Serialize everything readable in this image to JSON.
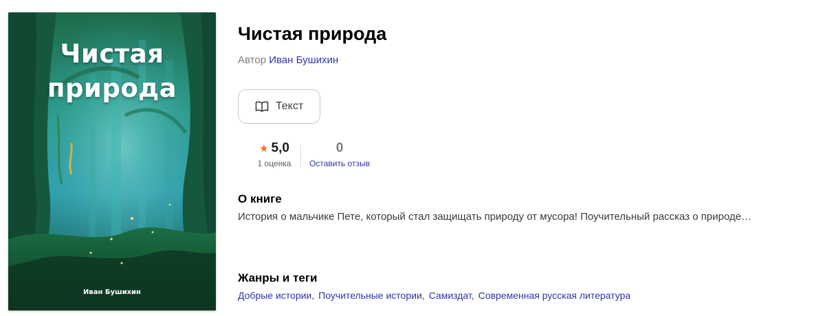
{
  "cover": {
    "title_line1": "Чистая",
    "title_line2": "природа",
    "author": "Иван Бушихин"
  },
  "book": {
    "title": "Чистая природа",
    "author_prefix": "Автор",
    "author_name": "Иван Бушихин"
  },
  "format_button": {
    "label": "Текст",
    "icon": "open-book-icon"
  },
  "rating": {
    "value": "5,0",
    "count_label": "1 оценка",
    "star_color": "#f06a22"
  },
  "reviews": {
    "count": "0",
    "link_label": "Оставить отзыв"
  },
  "about": {
    "heading": "О книге",
    "text": "История о мальчике Пете, который стал защищать природу от мусора! Поучительный рассказ о природе…"
  },
  "genres": {
    "heading": "Жанры и теги",
    "tags": [
      "Добрые истории",
      "Поучительные истории",
      "Самиздат",
      "Современная русская литература"
    ],
    "separator": ","
  },
  "colors": {
    "link": "#2f34a8",
    "muted": "#7a7a80",
    "cover_green": "#1f8a5a",
    "cover_teal": "#2fa6b8"
  }
}
